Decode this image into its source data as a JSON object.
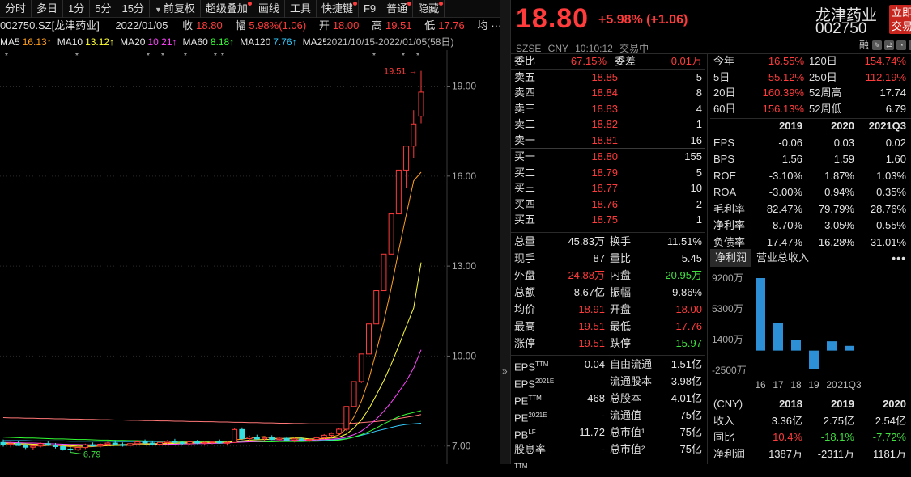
{
  "toolbar": [
    {
      "label": "分时",
      "dot": false,
      "tri": false
    },
    {
      "label": "多日",
      "dot": false,
      "tri": false
    },
    {
      "label": "1分",
      "dot": false,
      "tri": false
    },
    {
      "label": "5分",
      "dot": false,
      "tri": false
    },
    {
      "label": "15分",
      "dot": false,
      "tri": false
    },
    {
      "label": "前复权",
      "dot": false,
      "tri": true
    },
    {
      "label": "超级叠加",
      "dot": true,
      "tri": false
    },
    {
      "label": "画线",
      "dot": false,
      "tri": false
    },
    {
      "label": "工具",
      "dot": false,
      "tri": false
    },
    {
      "label": "快捷键",
      "dot": true,
      "tri": false
    },
    {
      "label": "F9",
      "dot": false,
      "tri": false
    },
    {
      "label": "普通",
      "dot": true,
      "tri": false
    },
    {
      "label": "隐藏",
      "dot": true,
      "tri": false
    }
  ],
  "info": {
    "code_name": "002750.SZ[龙津药业]",
    "date": "2022/01/05",
    "close_label": "收",
    "close": "18.80",
    "range_label": "幅",
    "range": "5.98%(1.06)",
    "open_label": "开",
    "open": "18.00",
    "high_label": "高",
    "high": "19.51",
    "low_label": "低",
    "low": "17.76",
    "avg_label": "均",
    "avg": "···"
  },
  "ma": [
    {
      "label": "MA5",
      "value": "16.13↑",
      "color": "#e6e6e6",
      "vcolor": "#ff9f1c"
    },
    {
      "label": "MA10",
      "value": "13.12↑",
      "color": "#e6e6e6",
      "vcolor": "#ffff33"
    },
    {
      "label": "MA20",
      "value": "10.21↑",
      "color": "#e6e6e6",
      "vcolor": "#ff44ff"
    },
    {
      "label": "MA60",
      "value": "8.18↑",
      "color": "#e6e6e6",
      "vcolor": "#33ff33"
    },
    {
      "label": "MA120",
      "value": "7.76↑",
      "color": "#e6e6e6",
      "vcolor": "#33ccff"
    },
    {
      "label": "MA250",
      "value": "",
      "color": "#e6e6e6",
      "vcolor": "#ff7777"
    }
  ],
  "range_note": "2021/10/15-2022/01/05(58日)",
  "chart_data": {
    "type": "candlestick",
    "y_ticks": [
      "19.00",
      "16.00",
      "13.00",
      "10.00",
      "7.00"
    ],
    "ylim": [
      6.4,
      20.2
    ],
    "high_marker": "19.51",
    "low_marker": "6.79",
    "candles": [
      {
        "o": 7.12,
        "h": 7.22,
        "l": 6.98,
        "c": 7.05
      },
      {
        "o": 7.05,
        "h": 7.15,
        "l": 6.95,
        "c": 7.08
      },
      {
        "o": 7.08,
        "h": 7.18,
        "l": 7.0,
        "c": 7.02
      },
      {
        "o": 7.02,
        "h": 7.1,
        "l": 6.9,
        "c": 6.96
      },
      {
        "o": 6.96,
        "h": 7.05,
        "l": 6.88,
        "c": 7.0
      },
      {
        "o": 7.0,
        "h": 7.12,
        "l": 6.95,
        "c": 7.08
      },
      {
        "o": 7.08,
        "h": 7.16,
        "l": 7.0,
        "c": 7.03
      },
      {
        "o": 7.03,
        "h": 7.1,
        "l": 6.92,
        "c": 6.98
      },
      {
        "o": 6.98,
        "h": 7.06,
        "l": 6.85,
        "c": 6.9
      },
      {
        "o": 6.9,
        "h": 6.98,
        "l": 6.79,
        "c": 6.88
      },
      {
        "o": 6.88,
        "h": 7.0,
        "l": 6.84,
        "c": 6.95
      },
      {
        "o": 6.95,
        "h": 7.08,
        "l": 6.9,
        "c": 7.04
      },
      {
        "o": 7.04,
        "h": 7.12,
        "l": 6.98,
        "c": 7.0
      },
      {
        "o": 7.0,
        "h": 7.1,
        "l": 6.94,
        "c": 7.06
      },
      {
        "o": 7.06,
        "h": 7.14,
        "l": 7.0,
        "c": 7.1
      },
      {
        "o": 7.1,
        "h": 7.2,
        "l": 7.02,
        "c": 7.05
      },
      {
        "o": 7.05,
        "h": 7.12,
        "l": 6.98,
        "c": 7.02
      },
      {
        "o": 7.02,
        "h": 7.1,
        "l": 6.95,
        "c": 7.08
      },
      {
        "o": 7.08,
        "h": 7.18,
        "l": 7.04,
        "c": 7.14
      },
      {
        "o": 7.14,
        "h": 7.22,
        "l": 7.06,
        "c": 7.1
      },
      {
        "o": 7.1,
        "h": 7.18,
        "l": 7.02,
        "c": 7.06
      },
      {
        "o": 7.06,
        "h": 7.14,
        "l": 7.0,
        "c": 7.12
      },
      {
        "o": 7.12,
        "h": 7.2,
        "l": 7.06,
        "c": 7.16
      },
      {
        "o": 7.16,
        "h": 7.24,
        "l": 7.08,
        "c": 7.12
      },
      {
        "o": 7.12,
        "h": 7.18,
        "l": 7.04,
        "c": 7.08
      },
      {
        "o": 7.08,
        "h": 7.16,
        "l": 7.02,
        "c": 7.14
      },
      {
        "o": 7.14,
        "h": 7.2,
        "l": 7.06,
        "c": 7.1
      },
      {
        "o": 7.1,
        "h": 7.16,
        "l": 7.04,
        "c": 7.12
      },
      {
        "o": 7.12,
        "h": 7.18,
        "l": 7.06,
        "c": 7.15
      },
      {
        "o": 7.15,
        "h": 7.22,
        "l": 7.08,
        "c": 7.1
      },
      {
        "o": 7.1,
        "h": 7.16,
        "l": 7.04,
        "c": 7.12
      },
      {
        "o": 7.12,
        "h": 7.6,
        "l": 7.1,
        "c": 7.55
      },
      {
        "o": 7.55,
        "h": 7.62,
        "l": 7.2,
        "c": 7.25
      },
      {
        "o": 7.25,
        "h": 7.35,
        "l": 7.15,
        "c": 7.3
      },
      {
        "o": 7.3,
        "h": 7.38,
        "l": 7.2,
        "c": 7.24
      },
      {
        "o": 7.24,
        "h": 7.32,
        "l": 7.16,
        "c": 7.28
      },
      {
        "o": 7.28,
        "h": 7.36,
        "l": 7.2,
        "c": 7.22
      },
      {
        "o": 7.22,
        "h": 7.3,
        "l": 7.14,
        "c": 7.26
      },
      {
        "o": 7.26,
        "h": 7.32,
        "l": 7.18,
        "c": 7.2
      },
      {
        "o": 7.2,
        "h": 7.28,
        "l": 7.12,
        "c": 7.24
      },
      {
        "o": 7.24,
        "h": 7.3,
        "l": 7.16,
        "c": 7.2
      },
      {
        "o": 7.2,
        "h": 7.26,
        "l": 7.12,
        "c": 7.22
      },
      {
        "o": 7.22,
        "h": 7.32,
        "l": 7.16,
        "c": 7.28
      },
      {
        "o": 7.28,
        "h": 7.4,
        "l": 7.22,
        "c": 7.36
      },
      {
        "o": 7.36,
        "h": 7.46,
        "l": 7.28,
        "c": 7.42
      },
      {
        "o": 7.42,
        "h": 7.6,
        "l": 7.38,
        "c": 7.56
      },
      {
        "o": 7.56,
        "h": 8.32,
        "l": 7.5,
        "c": 8.32
      },
      {
        "o": 8.32,
        "h": 9.15,
        "l": 8.3,
        "c": 9.15
      },
      {
        "o": 9.15,
        "h": 10.07,
        "l": 9.1,
        "c": 10.07
      },
      {
        "o": 10.07,
        "h": 11.07,
        "l": 10.07,
        "c": 11.07
      },
      {
        "o": 11.07,
        "h": 12.18,
        "l": 11.07,
        "c": 12.18
      },
      {
        "o": 12.18,
        "h": 13.4,
        "l": 12.18,
        "c": 13.4
      },
      {
        "o": 13.4,
        "h": 14.74,
        "l": 13.4,
        "c": 14.74
      },
      {
        "o": 14.74,
        "h": 16.2,
        "l": 14.74,
        "c": 16.2
      },
      {
        "o": 16.2,
        "h": 17.0,
        "l": 15.6,
        "c": 17.0
      },
      {
        "o": 17.0,
        "h": 18.2,
        "l": 16.6,
        "c": 17.74
      },
      {
        "o": 18.0,
        "h": 19.51,
        "l": 17.76,
        "c": 18.8
      }
    ],
    "ma5": [
      7.08,
      7.06,
      7.05,
      7.04,
      7.02,
      7.0,
      7.02,
      7.03,
      7.0,
      6.98,
      6.96,
      6.97,
      6.98,
      7.0,
      7.03,
      7.05,
      7.05,
      7.06,
      7.08,
      7.08,
      7.08,
      7.09,
      7.1,
      7.12,
      7.12,
      7.12,
      7.12,
      7.12,
      7.12,
      7.12,
      7.12,
      7.21,
      7.23,
      7.27,
      7.29,
      7.32,
      7.26,
      7.26,
      7.24,
      7.24,
      7.23,
      7.22,
      7.23,
      7.26,
      7.3,
      7.37,
      7.58,
      7.97,
      8.5,
      9.23,
      10.16,
      11.14,
      12.28,
      13.52,
      14.7,
      15.84,
      16.13
    ],
    "ma10": [
      7.1,
      7.09,
      7.08,
      7.07,
      7.06,
      7.05,
      7.04,
      7.03,
      7.02,
      7.01,
      7.0,
      7.0,
      7.0,
      7.0,
      7.01,
      7.02,
      7.02,
      7.03,
      7.04,
      7.05,
      7.06,
      7.07,
      7.08,
      7.09,
      7.1,
      7.1,
      7.11,
      7.11,
      7.11,
      7.12,
      7.12,
      7.15,
      7.17,
      7.2,
      7.21,
      7.22,
      7.23,
      7.25,
      7.26,
      7.27,
      7.27,
      7.24,
      7.24,
      7.25,
      7.27,
      7.3,
      7.4,
      7.6,
      7.87,
      8.24,
      8.7,
      9.18,
      9.73,
      10.34,
      10.98,
      11.6,
      13.12
    ],
    "ma20": [
      7.12,
      7.12,
      7.11,
      7.1,
      7.1,
      7.09,
      7.08,
      7.07,
      7.06,
      7.05,
      7.05,
      7.04,
      7.04,
      7.04,
      7.04,
      7.04,
      7.04,
      7.04,
      7.04,
      7.05,
      7.05,
      7.05,
      7.06,
      7.06,
      7.07,
      7.07,
      7.08,
      7.08,
      7.09,
      7.09,
      7.1,
      7.12,
      7.13,
      7.14,
      7.15,
      7.16,
      7.17,
      7.18,
      7.18,
      7.19,
      7.2,
      7.2,
      7.21,
      7.22,
      7.23,
      7.25,
      7.3,
      7.38,
      7.5,
      7.68,
      7.9,
      8.16,
      8.46,
      8.8,
      9.16,
      9.6,
      10.21
    ],
    "ma60": [
      7.3,
      7.29,
      7.28,
      7.27,
      7.27,
      7.26,
      7.25,
      7.24,
      7.24,
      7.23,
      7.22,
      7.22,
      7.21,
      7.2,
      7.2,
      7.19,
      7.19,
      7.18,
      7.18,
      7.17,
      7.17,
      7.16,
      7.16,
      7.16,
      7.15,
      7.15,
      7.15,
      7.14,
      7.14,
      7.14,
      7.14,
      7.14,
      7.14,
      7.14,
      7.14,
      7.14,
      7.14,
      7.15,
      7.15,
      7.15,
      7.15,
      7.16,
      7.16,
      7.17,
      7.18,
      7.2,
      7.24,
      7.3,
      7.38,
      7.48,
      7.6,
      7.74,
      7.86,
      7.98,
      8.06,
      8.12,
      8.18
    ],
    "ma120": [
      7.18,
      7.18,
      7.18,
      7.18,
      7.17,
      7.17,
      7.17,
      7.17,
      7.17,
      7.16,
      7.16,
      7.16,
      7.16,
      7.16,
      7.16,
      7.15,
      7.15,
      7.15,
      7.15,
      7.15,
      7.15,
      7.15,
      7.15,
      7.15,
      7.15,
      7.15,
      7.15,
      7.15,
      7.15,
      7.15,
      7.15,
      7.16,
      7.16,
      7.16,
      7.16,
      7.17,
      7.17,
      7.17,
      7.17,
      7.18,
      7.18,
      7.18,
      7.19,
      7.19,
      7.2,
      7.22,
      7.25,
      7.3,
      7.36,
      7.42,
      7.5,
      7.56,
      7.62,
      7.68,
      7.72,
      7.74,
      7.76
    ],
    "ma250": [
      7.95,
      7.94,
      7.94,
      7.93,
      7.93,
      7.92,
      7.92,
      7.91,
      7.91,
      7.9,
      7.9,
      7.89,
      7.89,
      7.88,
      7.88,
      7.87,
      7.87,
      7.86,
      7.86,
      7.85,
      7.85,
      7.84,
      7.84,
      7.83,
      7.83,
      7.82,
      7.82,
      7.81,
      7.81,
      7.8,
      7.8,
      7.79,
      7.79,
      7.78,
      7.78,
      7.77,
      7.77,
      7.76,
      7.76,
      7.75,
      7.75,
      7.74,
      7.74,
      7.74,
      7.74,
      7.74,
      7.75,
      7.76,
      7.78,
      7.8,
      7.82,
      7.85,
      7.88,
      7.92,
      7.96,
      8.0,
      8.05
    ]
  },
  "header": {
    "price": "18.80",
    "change": "+5.98% (+1.06)",
    "name": "龙津药业",
    "code": "002750",
    "trade_btn": "立即交易",
    "meta": "SZSE CNY 10:10:12 交易中",
    "rong": "融"
  },
  "orderbook": {
    "wb_label": "委比",
    "wb": "67.15%",
    "wc_label": "委差",
    "wc": "0.01万",
    "sell": [
      {
        "label": "卖五",
        "price": "18.85",
        "vol": "5"
      },
      {
        "label": "卖四",
        "price": "18.84",
        "vol": "8"
      },
      {
        "label": "卖三",
        "price": "18.83",
        "vol": "4"
      },
      {
        "label": "卖二",
        "price": "18.82",
        "vol": "1"
      },
      {
        "label": "卖一",
        "price": "18.81",
        "vol": "16"
      }
    ],
    "buy": [
      {
        "label": "买一",
        "price": "18.80",
        "vol": "155"
      },
      {
        "label": "买二",
        "price": "18.79",
        "vol": "5"
      },
      {
        "label": "买三",
        "price": "18.77",
        "vol": "10"
      },
      {
        "label": "买四",
        "price": "18.76",
        "vol": "2"
      },
      {
        "label": "买五",
        "price": "18.75",
        "vol": "1"
      }
    ]
  },
  "quote": [
    {
      "k1": "总量",
      "v1": "45.83万",
      "c1": "wht",
      "k2": "换手",
      "v2": "11.51%",
      "c2": "wht"
    },
    {
      "k1": "现手",
      "v1": "87",
      "c1": "wht",
      "k2": "量比",
      "v2": "5.45",
      "c2": "wht"
    },
    {
      "k1": "外盘",
      "v1": "24.88万",
      "c1": "red",
      "k2": "内盘",
      "v2": "20.95万",
      "c2": "grn"
    },
    {
      "k1": "总额",
      "v1": "8.67亿",
      "c1": "wht",
      "k2": "振幅",
      "v2": "9.86%",
      "c2": "wht"
    },
    {
      "k1": "均价",
      "v1": "18.91",
      "c1": "red",
      "k2": "开盘",
      "v2": "18.00",
      "c2": "red"
    },
    {
      "k1": "最高",
      "v1": "19.51",
      "c1": "red",
      "k2": "最低",
      "v2": "17.76",
      "c2": "red"
    },
    {
      "k1": "涨停",
      "v1": "19.51",
      "c1": "red",
      "k2": "跌停",
      "v2": "15.97",
      "c2": "grn"
    }
  ],
  "fundamentals": [
    {
      "k1": "EPS",
      "s1": "TTM",
      "v1": "0.04",
      "k2": "自由流通",
      "v2": "1.51亿"
    },
    {
      "k1": "EPS",
      "s1": "2021E",
      "v1": "",
      "k2": "流通股本",
      "v2": "3.98亿"
    },
    {
      "k1": "PE",
      "s1": "TTM",
      "v1": "468",
      "k2": "总股本",
      "v2": "4.01亿"
    },
    {
      "k1": "PE",
      "s1": "2021E",
      "v1": "-",
      "k2": "流通值",
      "v2": "75亿"
    },
    {
      "k1": "PB",
      "s1": "LF",
      "v1": "11.72",
      "k2": "总市值¹",
      "v2": "75亿"
    },
    {
      "k1": "股息率",
      "s1": "TTM",
      "v1": "-",
      "k2": "总市值²",
      "v2": "75亿"
    }
  ],
  "returns": [
    {
      "k1": "今年",
      "v1": "16.55%",
      "k2": "120日",
      "v2": "154.74%",
      "c2": "red"
    },
    {
      "k1": "5日",
      "v1": "55.12%",
      "k2": "250日",
      "v2": "112.19%",
      "c2": "red"
    },
    {
      "k1": "20日",
      "v1": "160.39%",
      "k2": "52周高",
      "v2": "17.74",
      "c2": "wht"
    },
    {
      "k1": "60日",
      "v1": "156.13%",
      "k2": "52周低",
      "v2": "6.79",
      "c2": "wht"
    }
  ],
  "fin_table": {
    "years": [
      "2019",
      "2020",
      "2021Q3"
    ],
    "rows": [
      {
        "k": "EPS",
        "v": [
          "-0.06",
          "0.03",
          "0.02"
        ]
      },
      {
        "k": "BPS",
        "v": [
          "1.56",
          "1.59",
          "1.60"
        ]
      },
      {
        "k": "ROE",
        "v": [
          "-3.10%",
          "1.87%",
          "1.03%"
        ]
      },
      {
        "k": "ROA",
        "v": [
          "-3.00%",
          "0.94%",
          "0.35%"
        ]
      },
      {
        "k": "毛利率",
        "v": [
          "82.47%",
          "79.79%",
          "28.76%"
        ]
      },
      {
        "k": "净利率",
        "v": [
          "-8.70%",
          "3.05%",
          "0.55%"
        ]
      },
      {
        "k": "负债率",
        "v": [
          "17.47%",
          "16.28%",
          "31.01%"
        ]
      }
    ]
  },
  "tabs": {
    "t1": "净利润",
    "t2": "营业总收入",
    "more": "•••"
  },
  "profit_chart": {
    "y_labels": [
      "9200万",
      "5300万",
      "1400万",
      "-2500万"
    ],
    "categories": [
      "16",
      "17",
      "18",
      "19",
      "20",
      "21Q3"
    ],
    "values": [
      9200,
      3500,
      1387,
      -2311,
      1181,
      600
    ],
    "ylim": [
      -2500,
      9200
    ]
  },
  "rev_table": {
    "unit": "(CNY)",
    "years": [
      "2018",
      "2019",
      "2020"
    ],
    "rows": [
      {
        "k": "收入",
        "v": [
          "3.36亿",
          "2.75亿",
          "2.54亿"
        ],
        "c": [
          "wht",
          "wht",
          "wht"
        ]
      },
      {
        "k": "同比",
        "v": [
          "10.4%",
          "-18.1%",
          "-7.72%"
        ],
        "c": [
          "red",
          "grn",
          "grn"
        ]
      },
      {
        "k": "净利润",
        "v": [
          "1387万",
          "-2311万",
          "1181万"
        ],
        "c": [
          "wht",
          "wht",
          "wht"
        ]
      }
    ]
  }
}
